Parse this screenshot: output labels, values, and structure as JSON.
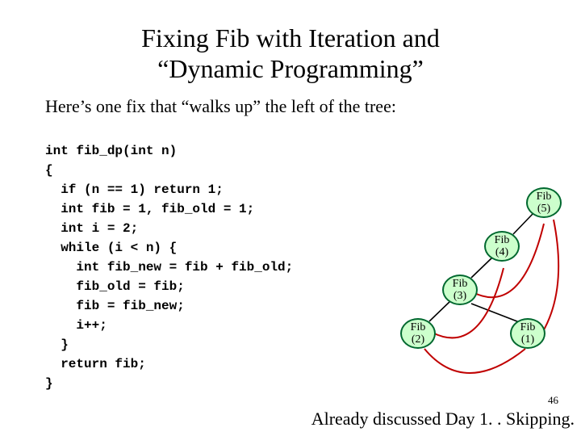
{
  "title_line1": "Fixing Fib with Iteration and",
  "title_line2": "“Dynamic Programming”",
  "intro": "Here’s one fix that “walks up” the left of the tree:",
  "code": {
    "l0": "int fib_dp(int n)",
    "l1": "{",
    "l2": "  if (n == 1) return 1;",
    "l3": "  int fib = 1, fib_old = 1;",
    "l4": "  int i = 2;",
    "l5": "  while (i < n) {",
    "l6": "    int fib_new = fib + fib_old;",
    "l7": "    fib_old = fib;",
    "l8": "    fib = fib_new;",
    "l9": "    i++;",
    "l10": "  }",
    "l11": "  return fib;",
    "l12": "}"
  },
  "nodes": {
    "n5a": "Fib",
    "n5b": "(5)",
    "n4a": "Fib",
    "n4b": "(4)",
    "n3a": "Fib",
    "n3b": "(3)",
    "n2a": "Fib",
    "n2b": "(2)",
    "n1a": "Fib",
    "n1b": "(1)"
  },
  "footer": "Already discussed Day 1. . Skipping.",
  "pagenum": "46"
}
